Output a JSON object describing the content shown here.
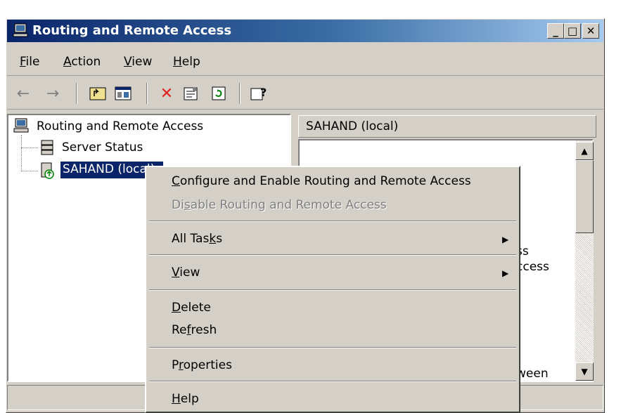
{
  "window": {
    "title": "Routing and Remote Access"
  },
  "caption_buttons": {
    "minimize": "_",
    "maximize": "□",
    "close": "✕"
  },
  "menubar": [
    {
      "before": "",
      "key": "F",
      "after": "ile"
    },
    {
      "before": "",
      "key": "A",
      "after": "ction"
    },
    {
      "before": "",
      "key": "V",
      "after": "iew"
    },
    {
      "before": "",
      "key": "H",
      "after": "elp"
    }
  ],
  "toolbar": {
    "back": "←",
    "forward": "→",
    "up": "⬑",
    "show_hide": "▦",
    "delete": "✕",
    "properties": "☰",
    "refresh": "⟳",
    "help": "?"
  },
  "tree": {
    "root": "Routing and Remote Access",
    "server_status": "Server Status",
    "server": "SAHAND (local)"
  },
  "detail": {
    "header": "SAHAND (local)",
    "fragments": [
      "ss",
      "ccess",
      "ween"
    ]
  },
  "context_menu": [
    {
      "before": "",
      "key": "C",
      "after": "onfigure and Enable Routing and Remote Access",
      "disabled": false
    },
    {
      "before": "Di",
      "key": "s",
      "after": "able Routing and Remote Access",
      "disabled": true
    },
    {
      "before": "All Tas",
      "key": "k",
      "after": "s",
      "submenu": true
    },
    {
      "before": "",
      "key": "V",
      "after": "iew",
      "submenu": true
    },
    {
      "before": "",
      "key": "D",
      "after": "elete"
    },
    {
      "before": "Re",
      "key": "f",
      "after": "resh"
    },
    {
      "before": "P",
      "key": "r",
      "after": "operties"
    },
    {
      "before": "",
      "key": "H",
      "after": "elp"
    }
  ],
  "submenu_arrow": "▶",
  "colors": {
    "titlebar_start": "#0a246a",
    "titlebar_end": "#a6caf0",
    "selection": "#0a246a",
    "face": "#d4d0c8"
  }
}
